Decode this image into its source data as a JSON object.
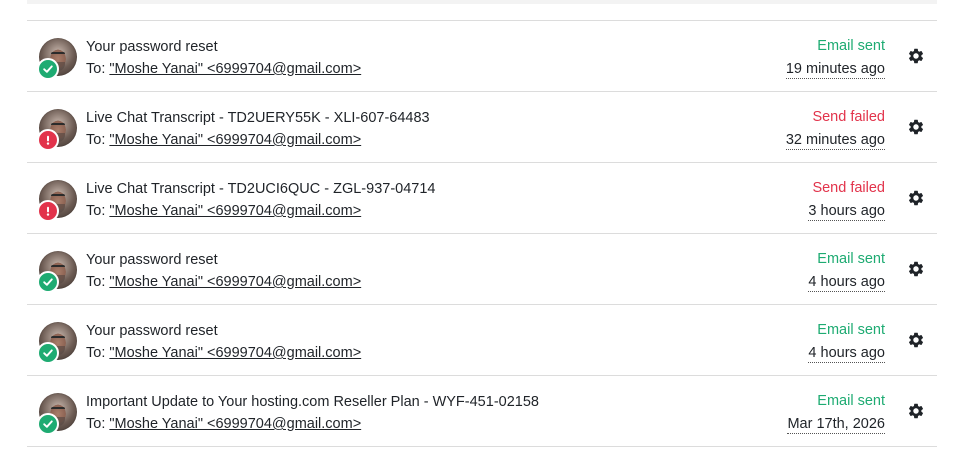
{
  "recipient_prefix": "To:",
  "emails": [
    {
      "subject": "Your password reset",
      "to": "\"Moshe Yanai\" <6999704@gmail.com>",
      "status": "Email sent",
      "status_type": "ok",
      "time": "19 minutes ago"
    },
    {
      "subject": "Live Chat Transcript - TD2UERY55K - XLI-607-64483",
      "to": "\"Moshe Yanai\" <6999704@gmail.com>",
      "status": "Send failed",
      "status_type": "fail",
      "time": "32 minutes ago"
    },
    {
      "subject": "Live Chat Transcript - TD2UCI6QUC - ZGL-937-04714",
      "to": "\"Moshe Yanai\" <6999704@gmail.com>",
      "status": "Send failed",
      "status_type": "fail",
      "time": "3 hours ago"
    },
    {
      "subject": "Your password reset",
      "to": "\"Moshe Yanai\" <6999704@gmail.com>",
      "status": "Email sent",
      "status_type": "ok",
      "time": "4 hours ago"
    },
    {
      "subject": "Your password reset",
      "to": "\"Moshe Yanai\" <6999704@gmail.com>",
      "status": "Email sent",
      "status_type": "ok",
      "time": "4 hours ago"
    },
    {
      "subject": "Important Update to Your hosting.com Reseller Plan - WYF-451-02158",
      "to": "\"Moshe Yanai\" <6999704@gmail.com>",
      "status": "Email sent",
      "status_type": "ok",
      "time": "Mar 17th, 2026"
    }
  ],
  "icons": {
    "sent": "check-circle-icon",
    "failed": "exclamation-circle-icon",
    "actions": "gear-icon"
  },
  "colors": {
    "sent": "#1eab72",
    "failed": "#e2334b",
    "text": "#1f2328",
    "divider": "#dcdcdc"
  }
}
